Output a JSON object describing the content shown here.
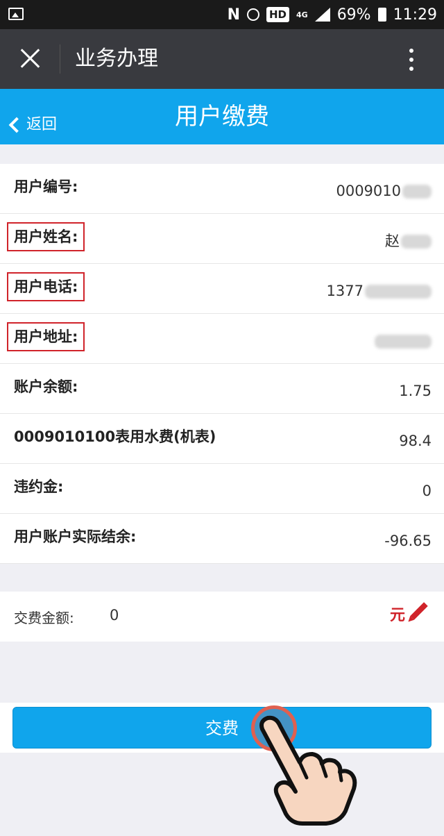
{
  "status_bar": {
    "nfc": "N",
    "hd": "HD",
    "network": "4G",
    "battery": "69%",
    "time": "11:29"
  },
  "title_bar": {
    "title": "业务办理"
  },
  "nav": {
    "back_label": "返回",
    "title": "用户缴费"
  },
  "details": [
    {
      "label": "用户编号:",
      "value": "0009010"
    },
    {
      "label": "用户姓名:",
      "value": "赵"
    },
    {
      "label": "用户电话:",
      "value": "1377"
    },
    {
      "label": "用户地址:",
      "value": ""
    },
    {
      "label": "账户余额:",
      "value": "1.75"
    },
    {
      "label": "0009010100表用水费(机表)",
      "value": "98.4"
    },
    {
      "label": "违约金:",
      "value": "0"
    },
    {
      "label": "用户账户实际结余:",
      "value": "-96.65"
    }
  ],
  "payment": {
    "label": "交费金额:",
    "value": "0",
    "unit": "元"
  },
  "submit_label": "交费",
  "colors": {
    "accent": "#10a5ec",
    "highlight": "#d0232a"
  }
}
